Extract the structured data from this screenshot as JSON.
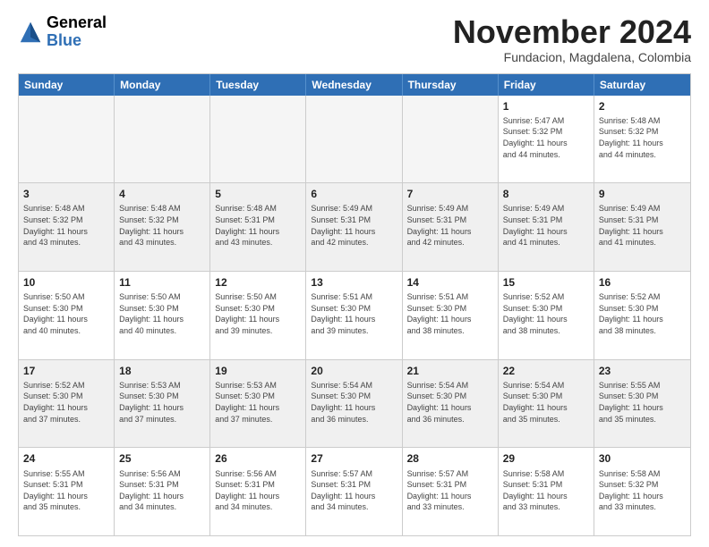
{
  "logo": {
    "line1": "General",
    "line2": "Blue"
  },
  "title": "November 2024",
  "subtitle": "Fundacion, Magdalena, Colombia",
  "header": {
    "days": [
      "Sunday",
      "Monday",
      "Tuesday",
      "Wednesday",
      "Thursday",
      "Friday",
      "Saturday"
    ]
  },
  "rows": [
    [
      {
        "day": "",
        "empty": true
      },
      {
        "day": "",
        "empty": true
      },
      {
        "day": "",
        "empty": true
      },
      {
        "day": "",
        "empty": true
      },
      {
        "day": "",
        "empty": true
      },
      {
        "day": "1",
        "info": "Sunrise: 5:47 AM\nSunset: 5:32 PM\nDaylight: 11 hours\nand 44 minutes."
      },
      {
        "day": "2",
        "info": "Sunrise: 5:48 AM\nSunset: 5:32 PM\nDaylight: 11 hours\nand 44 minutes."
      }
    ],
    [
      {
        "day": "3",
        "info": "Sunrise: 5:48 AM\nSunset: 5:32 PM\nDaylight: 11 hours\nand 43 minutes."
      },
      {
        "day": "4",
        "info": "Sunrise: 5:48 AM\nSunset: 5:32 PM\nDaylight: 11 hours\nand 43 minutes."
      },
      {
        "day": "5",
        "info": "Sunrise: 5:48 AM\nSunset: 5:31 PM\nDaylight: 11 hours\nand 43 minutes."
      },
      {
        "day": "6",
        "info": "Sunrise: 5:49 AM\nSunset: 5:31 PM\nDaylight: 11 hours\nand 42 minutes."
      },
      {
        "day": "7",
        "info": "Sunrise: 5:49 AM\nSunset: 5:31 PM\nDaylight: 11 hours\nand 42 minutes."
      },
      {
        "day": "8",
        "info": "Sunrise: 5:49 AM\nSunset: 5:31 PM\nDaylight: 11 hours\nand 41 minutes."
      },
      {
        "day": "9",
        "info": "Sunrise: 5:49 AM\nSunset: 5:31 PM\nDaylight: 11 hours\nand 41 minutes."
      }
    ],
    [
      {
        "day": "10",
        "info": "Sunrise: 5:50 AM\nSunset: 5:30 PM\nDaylight: 11 hours\nand 40 minutes."
      },
      {
        "day": "11",
        "info": "Sunrise: 5:50 AM\nSunset: 5:30 PM\nDaylight: 11 hours\nand 40 minutes."
      },
      {
        "day": "12",
        "info": "Sunrise: 5:50 AM\nSunset: 5:30 PM\nDaylight: 11 hours\nand 39 minutes."
      },
      {
        "day": "13",
        "info": "Sunrise: 5:51 AM\nSunset: 5:30 PM\nDaylight: 11 hours\nand 39 minutes."
      },
      {
        "day": "14",
        "info": "Sunrise: 5:51 AM\nSunset: 5:30 PM\nDaylight: 11 hours\nand 38 minutes."
      },
      {
        "day": "15",
        "info": "Sunrise: 5:52 AM\nSunset: 5:30 PM\nDaylight: 11 hours\nand 38 minutes."
      },
      {
        "day": "16",
        "info": "Sunrise: 5:52 AM\nSunset: 5:30 PM\nDaylight: 11 hours\nand 38 minutes."
      }
    ],
    [
      {
        "day": "17",
        "info": "Sunrise: 5:52 AM\nSunset: 5:30 PM\nDaylight: 11 hours\nand 37 minutes."
      },
      {
        "day": "18",
        "info": "Sunrise: 5:53 AM\nSunset: 5:30 PM\nDaylight: 11 hours\nand 37 minutes."
      },
      {
        "day": "19",
        "info": "Sunrise: 5:53 AM\nSunset: 5:30 PM\nDaylight: 11 hours\nand 37 minutes."
      },
      {
        "day": "20",
        "info": "Sunrise: 5:54 AM\nSunset: 5:30 PM\nDaylight: 11 hours\nand 36 minutes."
      },
      {
        "day": "21",
        "info": "Sunrise: 5:54 AM\nSunset: 5:30 PM\nDaylight: 11 hours\nand 36 minutes."
      },
      {
        "day": "22",
        "info": "Sunrise: 5:54 AM\nSunset: 5:30 PM\nDaylight: 11 hours\nand 35 minutes."
      },
      {
        "day": "23",
        "info": "Sunrise: 5:55 AM\nSunset: 5:30 PM\nDaylight: 11 hours\nand 35 minutes."
      }
    ],
    [
      {
        "day": "24",
        "info": "Sunrise: 5:55 AM\nSunset: 5:31 PM\nDaylight: 11 hours\nand 35 minutes."
      },
      {
        "day": "25",
        "info": "Sunrise: 5:56 AM\nSunset: 5:31 PM\nDaylight: 11 hours\nand 34 minutes."
      },
      {
        "day": "26",
        "info": "Sunrise: 5:56 AM\nSunset: 5:31 PM\nDaylight: 11 hours\nand 34 minutes."
      },
      {
        "day": "27",
        "info": "Sunrise: 5:57 AM\nSunset: 5:31 PM\nDaylight: 11 hours\nand 34 minutes."
      },
      {
        "day": "28",
        "info": "Sunrise: 5:57 AM\nSunset: 5:31 PM\nDaylight: 11 hours\nand 33 minutes."
      },
      {
        "day": "29",
        "info": "Sunrise: 5:58 AM\nSunset: 5:31 PM\nDaylight: 11 hours\nand 33 minutes."
      },
      {
        "day": "30",
        "info": "Sunrise: 5:58 AM\nSunset: 5:32 PM\nDaylight: 11 hours\nand 33 minutes."
      }
    ]
  ]
}
